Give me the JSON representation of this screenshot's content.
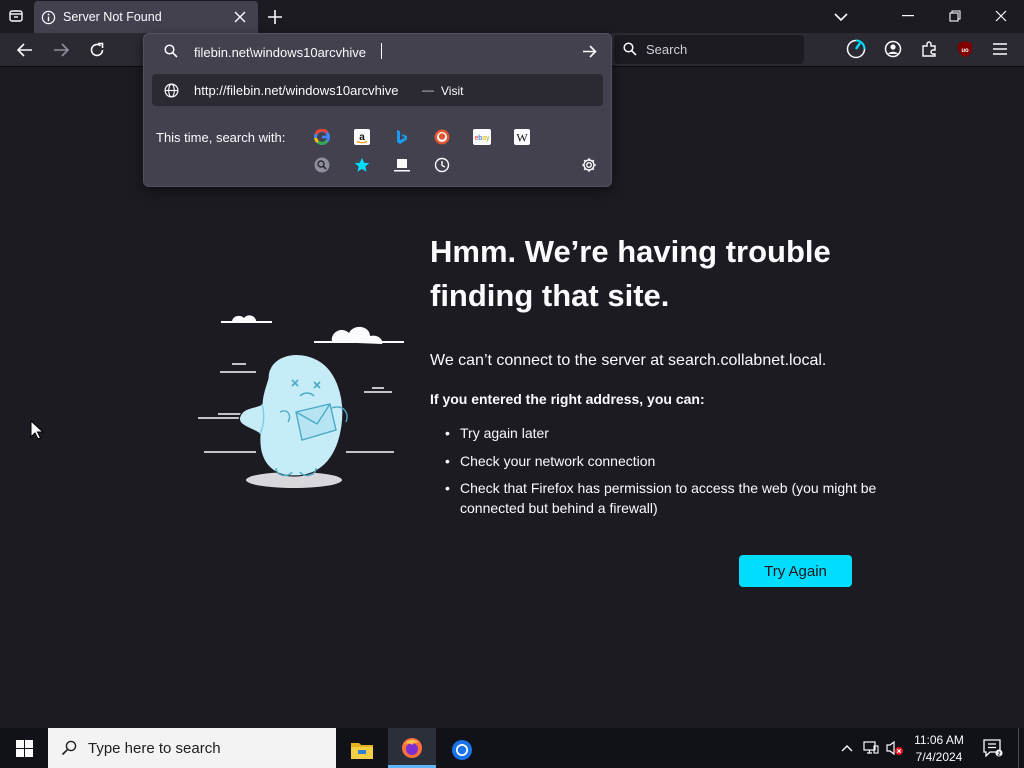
{
  "tab": {
    "title": "Server Not Found"
  },
  "urlbar": {
    "typed_text": "filebin.net\\windows10arcvhive",
    "suggestion_url": "http://filebin.net/windows10arcvhive",
    "suggestion_sep": "—",
    "suggestion_action": "Visit",
    "search_with_label": "This time, search with:",
    "engines": [
      "google-icon",
      "amazon-icon",
      "bing-icon",
      "duckduckgo-icon",
      "ebay-icon",
      "wikipedia-icon"
    ],
    "modes": [
      "search-history-icon",
      "bookmarks-star-icon",
      "tabs-icon",
      "history-clock-icon"
    ]
  },
  "search": {
    "placeholder": "Search"
  },
  "error": {
    "title": "Hmm. We’re having trouble finding that site.",
    "description": "We can’t connect to the server at search.collabnet.local.",
    "help_heading": "If you entered the right address, you can:",
    "items": [
      "Try again later",
      "Check your network connection",
      "Check that Firefox has permission to access the web (you might be connected but behind a firewall)"
    ],
    "button": "Try Again"
  },
  "taskbar": {
    "search_placeholder": "Type here to search",
    "time": "11:06 AM",
    "date": "7/4/2024"
  },
  "colors": {
    "page_bg": "#1c1b22",
    "toolbar_bg": "#2b2a33",
    "popup_bg": "#42414d",
    "accent": "#00ddff",
    "taskbar_bg": "#101217"
  }
}
